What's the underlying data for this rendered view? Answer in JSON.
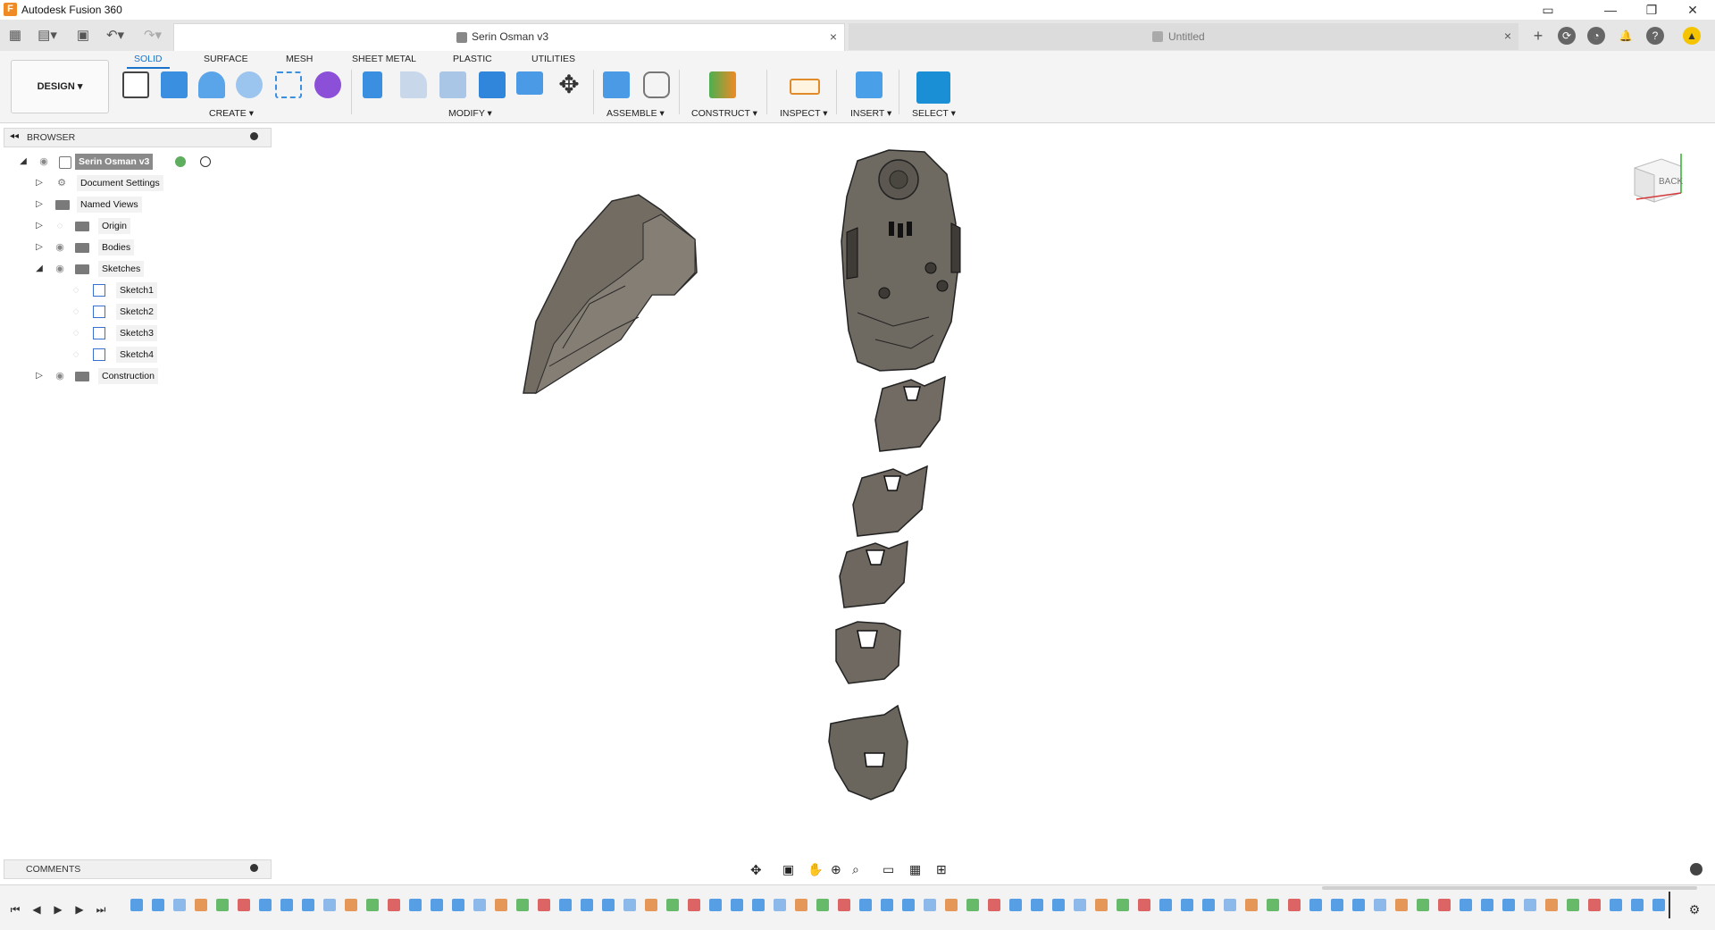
{
  "app": {
    "title": "Autodesk Fusion 360",
    "logo_letter": "F"
  },
  "window_controls": {
    "minimize": "—",
    "restore": "❐",
    "close": "✕",
    "extra": "▭"
  },
  "tabs": [
    {
      "label": "Serin Osman v3",
      "active": true
    },
    {
      "label": "Untitled",
      "active": false
    }
  ],
  "tab_close": "×",
  "new_tab": "+",
  "ribbon_tabs": [
    "SOLID",
    "SURFACE",
    "MESH",
    "SHEET METAL",
    "PLASTIC",
    "UTILITIES"
  ],
  "workspace": "DESIGN ▾",
  "groups": [
    "CREATE ▾",
    "MODIFY ▾",
    "ASSEMBLE ▾",
    "CONSTRUCT ▾",
    "INSPECT ▾",
    "INSERT ▾",
    "SELECT ▾"
  ],
  "browser": {
    "title": "BROWSER",
    "root": "Serin Osman v3",
    "items": [
      "Document Settings",
      "Named Views",
      "Origin",
      "Bodies",
      "Sketches",
      "Construction"
    ],
    "sketches": [
      "Sketch1",
      "Sketch2",
      "Sketch3",
      "Sketch4"
    ]
  },
  "comments": {
    "title": "COMMENTS"
  },
  "viewcube": {
    "face": "BACK"
  },
  "colors": {
    "accent": "#1a73c9",
    "model": "#6b665e",
    "select_tool": "#1a8fd6"
  }
}
